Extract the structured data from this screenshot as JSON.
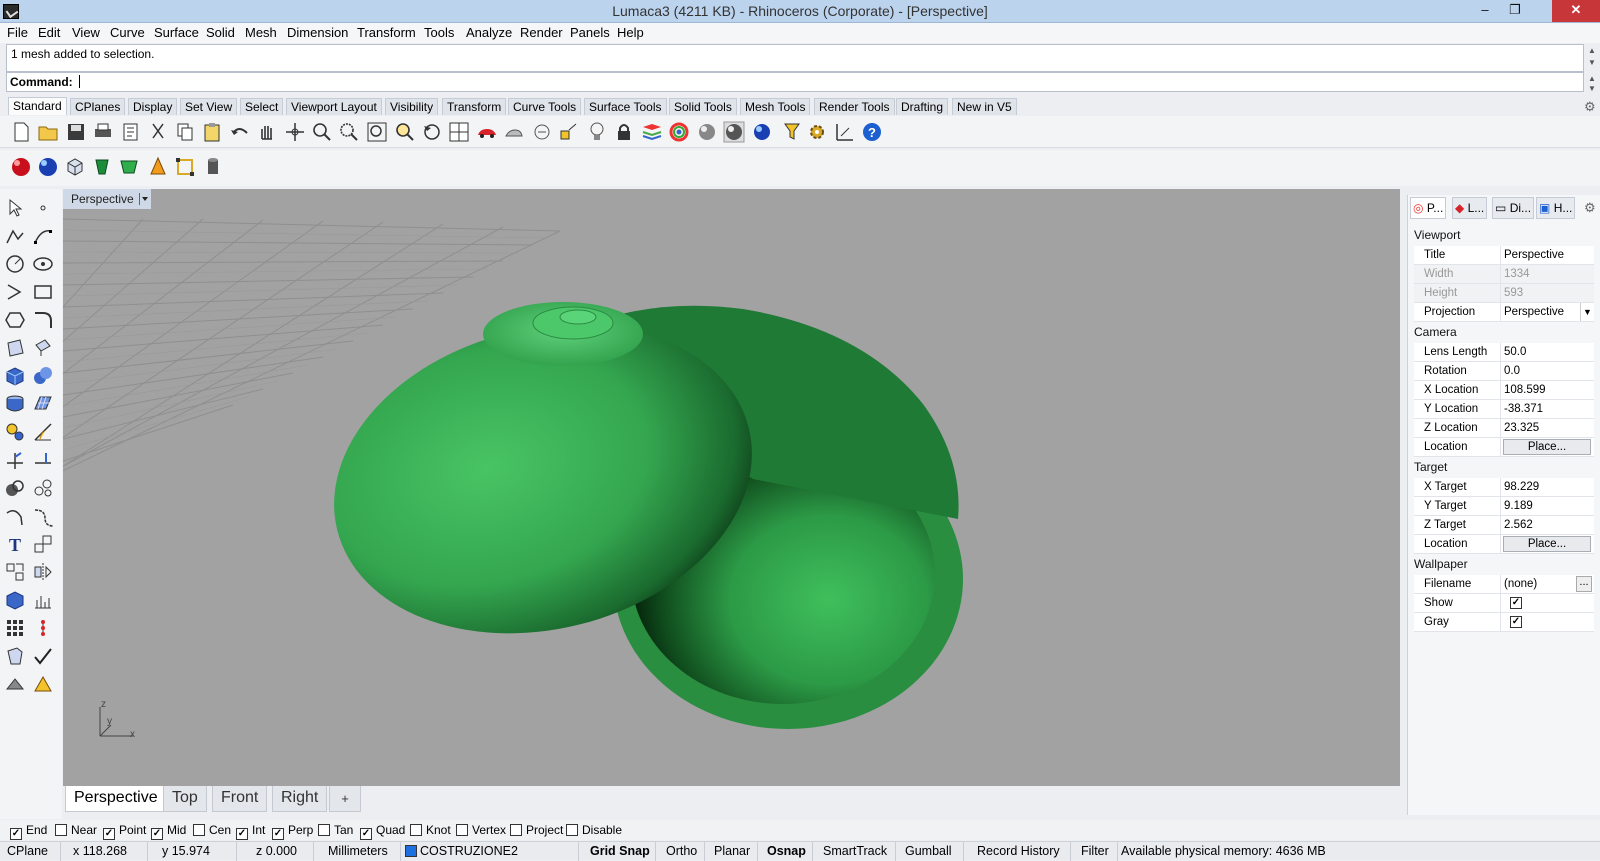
{
  "window": {
    "title": "Lumaca3 (4211 KB) - Rhinoceros (Corporate) - [Perspective]",
    "minimize": "–",
    "restore": "❐",
    "close": "✕"
  },
  "menu": [
    "File",
    "Edit",
    "View",
    "Curve",
    "Surface",
    "Solid",
    "Mesh",
    "Dimension",
    "Transform",
    "Tools",
    "Analyze",
    "Render",
    "Panels",
    "Help"
  ],
  "command": {
    "history": "1 mesh added to selection.",
    "prompt": "Command:",
    "value": ""
  },
  "toolbar_tabs": [
    "Standard",
    "CPlanes",
    "Display",
    "Set View",
    "Select",
    "Viewport Layout",
    "Visibility",
    "Transform",
    "Curve Tools",
    "Surface Tools",
    "Solid Tools",
    "Mesh Tools",
    "Render Tools",
    "Drafting",
    "New in V5"
  ],
  "active_toolbar_tab": "Standard",
  "viewport": {
    "title": "Perspective",
    "axis_labels": {
      "z": "z",
      "y": "y",
      "x": "x"
    },
    "object_color": "#3cb35a",
    "background_color": "#a2a2a2"
  },
  "viewport_tabs": [
    "Perspective",
    "Top",
    "Front",
    "Right",
    "+"
  ],
  "active_viewport_tab": "Perspective",
  "panel": {
    "tabs": [
      "P...",
      "L...",
      "Di...",
      "H..."
    ],
    "viewport_section": "Viewport",
    "viewport": [
      {
        "label": "Title",
        "value": "Perspective"
      },
      {
        "label": "Width",
        "value": "1334"
      },
      {
        "label": "Height",
        "value": "593"
      },
      {
        "label": "Projection",
        "value": "Perspective"
      }
    ],
    "camera_section": "Camera",
    "camera": [
      {
        "label": "Lens Length",
        "value": "50.0"
      },
      {
        "label": "Rotation",
        "value": "0.0"
      },
      {
        "label": "X Location",
        "value": "108.599"
      },
      {
        "label": "Y Location",
        "value": "-38.371"
      },
      {
        "label": "Z Location",
        "value": "23.325"
      },
      {
        "label": "Location",
        "value": "Place..."
      }
    ],
    "target_section": "Target",
    "target": [
      {
        "label": "X Target",
        "value": "98.229"
      },
      {
        "label": "Y Target",
        "value": "9.189"
      },
      {
        "label": "Z Target",
        "value": "2.562"
      },
      {
        "label": "Location",
        "value": "Place..."
      }
    ],
    "wallpaper_section": "Wallpaper",
    "wallpaper": [
      {
        "label": "Filename",
        "value": "(none)"
      },
      {
        "label": "Show",
        "value": "✓"
      },
      {
        "label": "Gray",
        "value": "✓"
      }
    ],
    "browse": "..."
  },
  "osnaps": [
    {
      "label": "End",
      "checked": true
    },
    {
      "label": "Near",
      "checked": false
    },
    {
      "label": "Point",
      "checked": true
    },
    {
      "label": "Mid",
      "checked": true
    },
    {
      "label": "Cen",
      "checked": false
    },
    {
      "label": "Int",
      "checked": true
    },
    {
      "label": "Perp",
      "checked": true
    },
    {
      "label": "Tan",
      "checked": false
    },
    {
      "label": "Quad",
      "checked": true
    },
    {
      "label": "Knot",
      "checked": false
    },
    {
      "label": "Vertex",
      "checked": false
    },
    {
      "label": "Project",
      "checked": false
    },
    {
      "label": "Disable",
      "checked": false
    }
  ],
  "status": {
    "cplane": "CPlane",
    "x": "x 118.268",
    "y": "y 15.974",
    "z": "z 0.000",
    "units": "Millimeters",
    "layer": "COSTRUZIONE2",
    "layer_color": "#1e6fe0",
    "grid_snap": "Grid Snap",
    "ortho": "Ortho",
    "planar": "Planar",
    "osnap": "Osnap",
    "smarttrack": "SmartTrack",
    "gumball": "Gumball",
    "record_history": "Record History",
    "filter": "Filter",
    "memory": "Available physical memory: 4636 MB"
  }
}
